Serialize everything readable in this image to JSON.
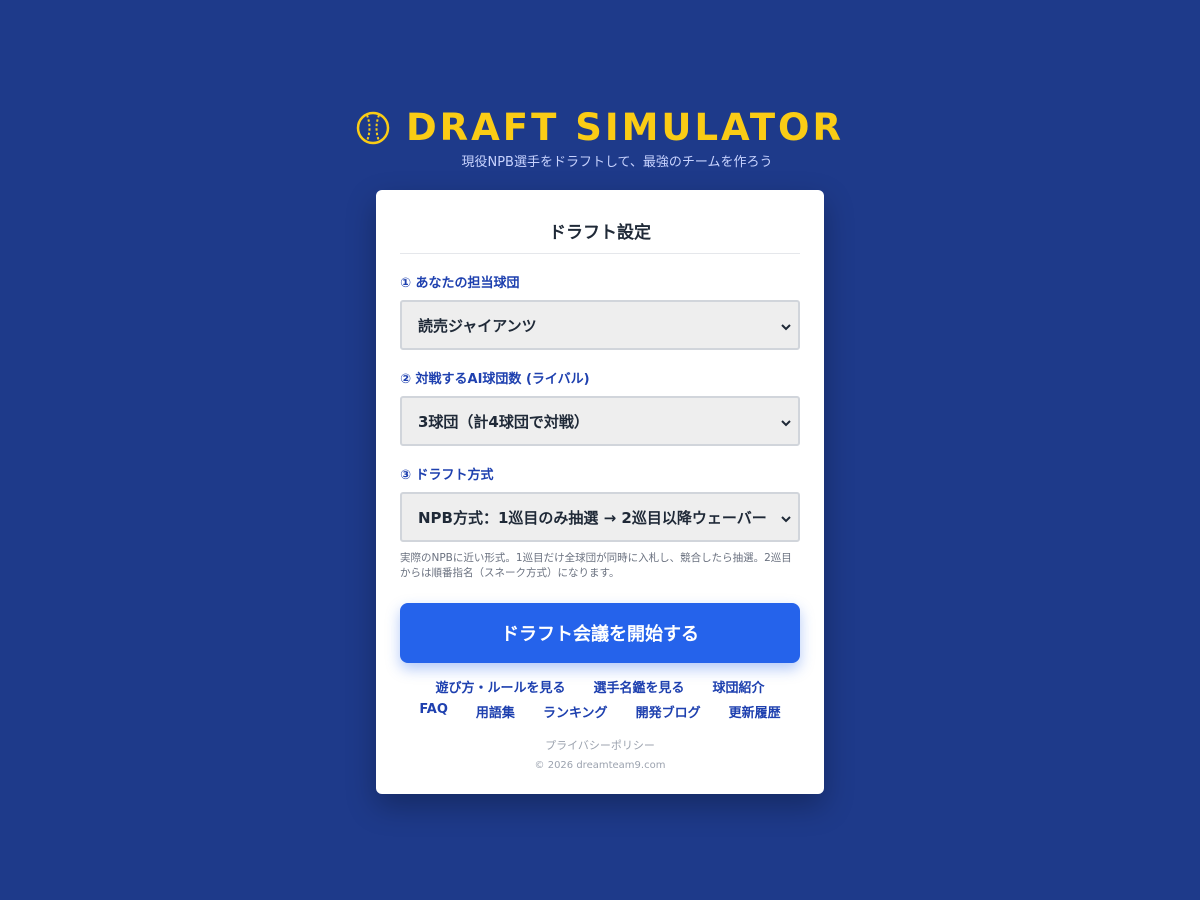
{
  "header": {
    "title": "DRAFT SIMULATOR",
    "tagline": "現役NPB選手をドラフトして、最強のチームを作ろう",
    "logo_icon": "baseball-icon",
    "accent_color": "#facc15",
    "background_color": "#1e3a8a"
  },
  "card": {
    "title": "ドラフト設定",
    "team_field": {
      "label": "① あなたの担当球団",
      "value": "読売ジャイアンツ"
    },
    "rivals_field": {
      "label": "② 対戦するAI球団数 (ライバル)",
      "value": "3球団（計4球団で対戦）"
    },
    "format_field": {
      "label": "③ ドラフト方式",
      "value": "NPB方式：1巡目のみ抽選 → 2巡目以降ウェーバー",
      "help": "実際のNPBに近い形式。1巡目だけ全球団が同時に入札し、競合したら抽選。2巡目からは順番指名（スネーク方式）になります。"
    },
    "start_button": "ドラフト会議を開始する",
    "button_color": "#2563eb"
  },
  "links": {
    "row1": [
      "遊び方・ルールを見る",
      "選手名鑑を見る",
      "球団紹介"
    ],
    "row2": [
      "FAQ",
      "用語集",
      "ランキング",
      "開発ブログ",
      "更新履歴"
    ]
  },
  "footer": {
    "privacy": "プライバシーポリシー",
    "copyright": "© 2026 dreamteam9.com"
  }
}
